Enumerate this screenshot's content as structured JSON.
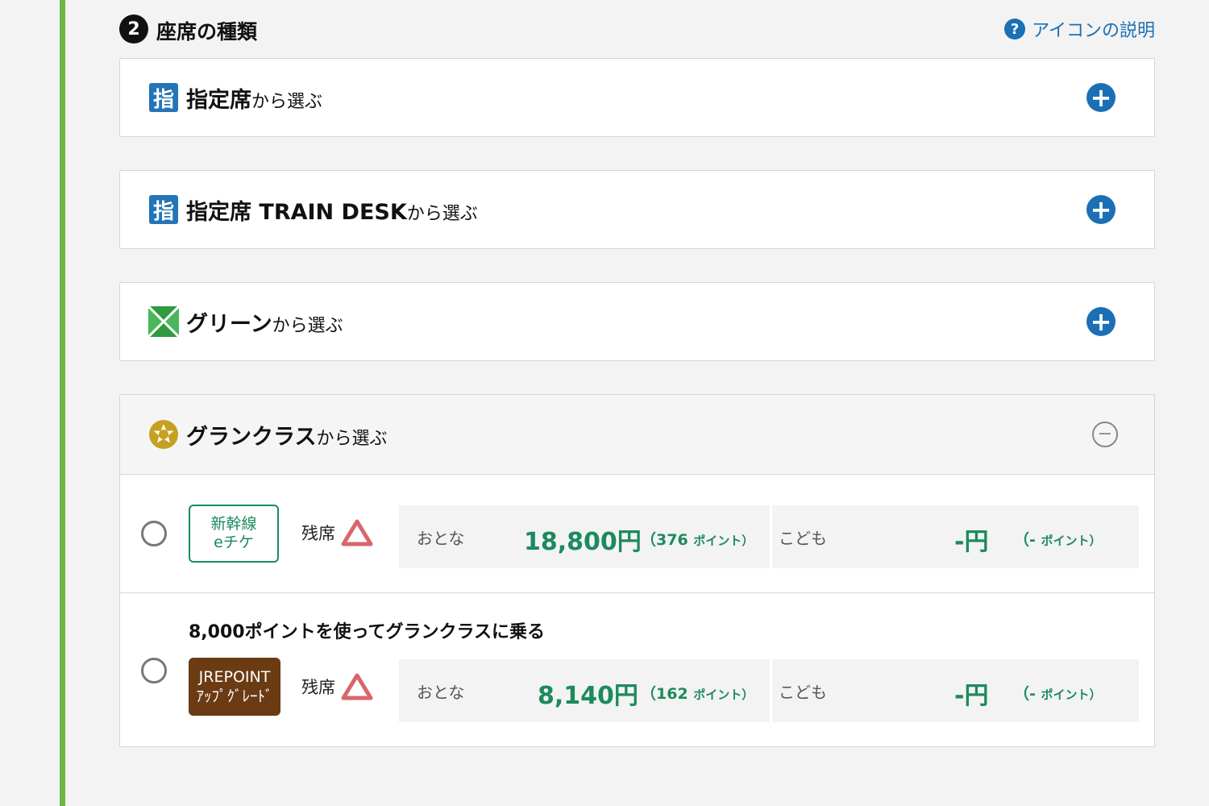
{
  "section": {
    "step_number": "2",
    "title": "座席の種類",
    "help_link": "アイコンの説明"
  },
  "cards": [
    {
      "icon_text": "指",
      "title": "指定席",
      "suffix": "から選ぶ"
    },
    {
      "icon_text": "指",
      "title": "指定席 TRAIN DESK",
      "suffix": "から選ぶ"
    },
    {
      "title": "グリーン",
      "suffix": "から選ぶ"
    },
    {
      "title": "グランクラス",
      "suffix": "から選ぶ"
    }
  ],
  "options": [
    {
      "badge_line1": "新幹線",
      "badge_line2": "eチケ",
      "availability": "残席",
      "adult_label": "おとな",
      "adult_price": "18,800円",
      "adult_points_open": "（376",
      "adult_points_unit": "ポイント）",
      "child_label": "こども",
      "child_price": "-円",
      "child_points_open": "（-",
      "child_points_unit": "ポイント）"
    },
    {
      "title": "8,000ポイントを使ってグランクラスに乗る",
      "badge_line1": "JREPOINT",
      "badge_line2": "ｱｯﾌﾟｸﾞﾚｰﾄﾞ",
      "availability": "残席",
      "adult_label": "おとな",
      "adult_price": "8,140円",
      "adult_points_open": "（162",
      "adult_points_unit": "ポイント）",
      "child_label": "こども",
      "child_price": "-円",
      "child_points_open": "（-",
      "child_points_unit": "ポイント）"
    }
  ],
  "colors": {
    "accent_blue": "#1a6fb5",
    "price_green": "#1c8a5e",
    "side_bar_green": "#6fb54a",
    "availability_triangle": "#d9666b",
    "green_car_icon": "#2e9b3f",
    "gran_class_icon": "#c6a020",
    "jre_badge_brown": "#6b3b14"
  }
}
